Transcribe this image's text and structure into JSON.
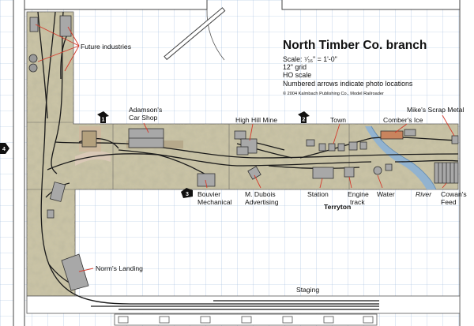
{
  "title": "North Timber Co. branch",
  "notes": {
    "scale": "Scale: ⁷⁄₁₆\" = 1'-0\"",
    "grid": "12\" grid",
    "ho": "HO scale",
    "arrows": "Numbered arrows indicate photo locations",
    "copyright": "© 2004 Kalmbach Publishing Co., Model Railroader"
  },
  "labels": {
    "future_industries": "Future industries",
    "adamsons": "Adamson's",
    "car_shop": "Car Shop",
    "high_hill_mine": "High Hill Mine",
    "town": "Town",
    "combers_ice": "Comber's Ice",
    "mikes_scrap": "Mike's Scrap Metal",
    "bouvier": "Bouvier",
    "mechanical": "Mechanical",
    "m_dubois": "M. Dubois",
    "advertising": "Advertising",
    "station": "Station",
    "engine": "Engine",
    "track": "track",
    "water": "Water",
    "river": "River",
    "cowans": "Cowan's",
    "feed": "Feed",
    "terryton": "Terryton",
    "norms_landing": "Norm's Landing",
    "staging": "Staging"
  },
  "photo_arrows": [
    "1",
    "2",
    "3",
    "4"
  ],
  "colors": {
    "grid": "#9db9de",
    "scenery": "#c9c3a5",
    "road": "#d9c8b6",
    "river": "#8fb2d3",
    "track": "#1a1a1a",
    "wall": "#444444"
  }
}
